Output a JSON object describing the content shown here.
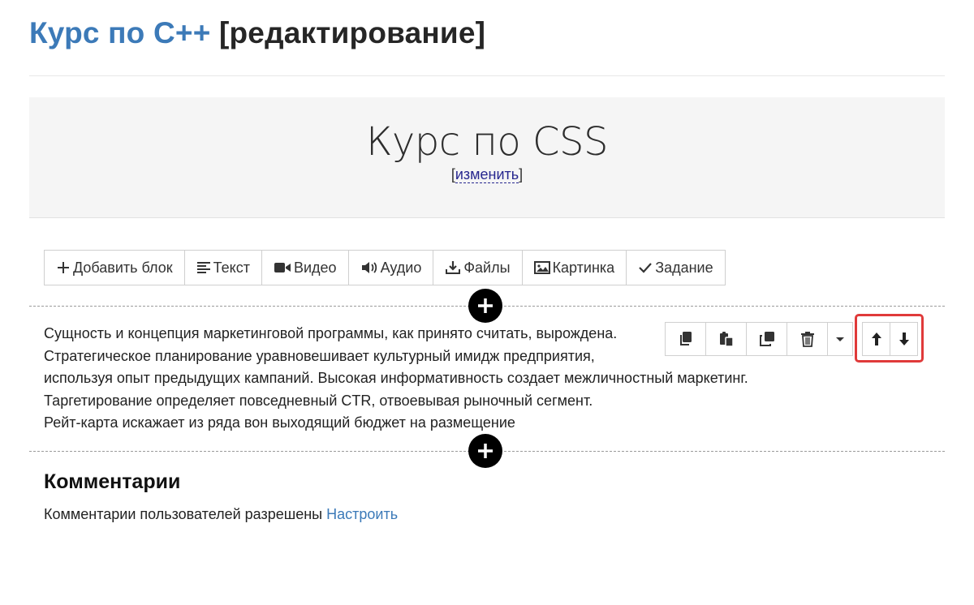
{
  "header": {
    "course_title": "Курс по C++",
    "mode_suffix": "[редактирование]"
  },
  "hero": {
    "title": "Курс по CSS",
    "edit_open": "[",
    "edit_label": "изменить",
    "edit_close": "]"
  },
  "toolbar": {
    "items": [
      {
        "label": "Добавить блок",
        "icon": "plus-icon"
      },
      {
        "label": "Текст",
        "icon": "align-left-icon"
      },
      {
        "label": "Видео",
        "icon": "video-camera-icon"
      },
      {
        "label": "Аудио",
        "icon": "volume-icon"
      },
      {
        "label": "Файлы",
        "icon": "download-icon"
      },
      {
        "label": "Картинка",
        "icon": "image-icon"
      },
      {
        "label": "Задание",
        "icon": "check-icon"
      }
    ]
  },
  "block": {
    "lines": [
      "Сущность и концепция маркетинговой программы, как принято считать, вырождена.",
      "Стратегическое планирование уравновешивает культурный имидж предприятия,",
      "используя опыт предыдущих кампаний. Высокая информативность создает межличностный маркетинг.",
      "Таргетирование определяет повседневный CTR, отвоевывая рыночный сегмент.",
      "Рейт-карта искажает из ряда вон выходящий бюджет на размещение"
    ],
    "actions": [
      "copy-icon",
      "paste-icon",
      "clone-icon",
      "trash-icon",
      "caret-down-icon"
    ],
    "move": [
      "arrow-up-icon",
      "arrow-down-icon"
    ]
  },
  "comments": {
    "title": "Комментарии",
    "status": "Комментарии пользователей разрешены",
    "configure_link": "Настроить"
  },
  "colors": {
    "accent": "#3c7ab8",
    "highlight": "#e03a3a",
    "edit_link": "#27278f"
  }
}
